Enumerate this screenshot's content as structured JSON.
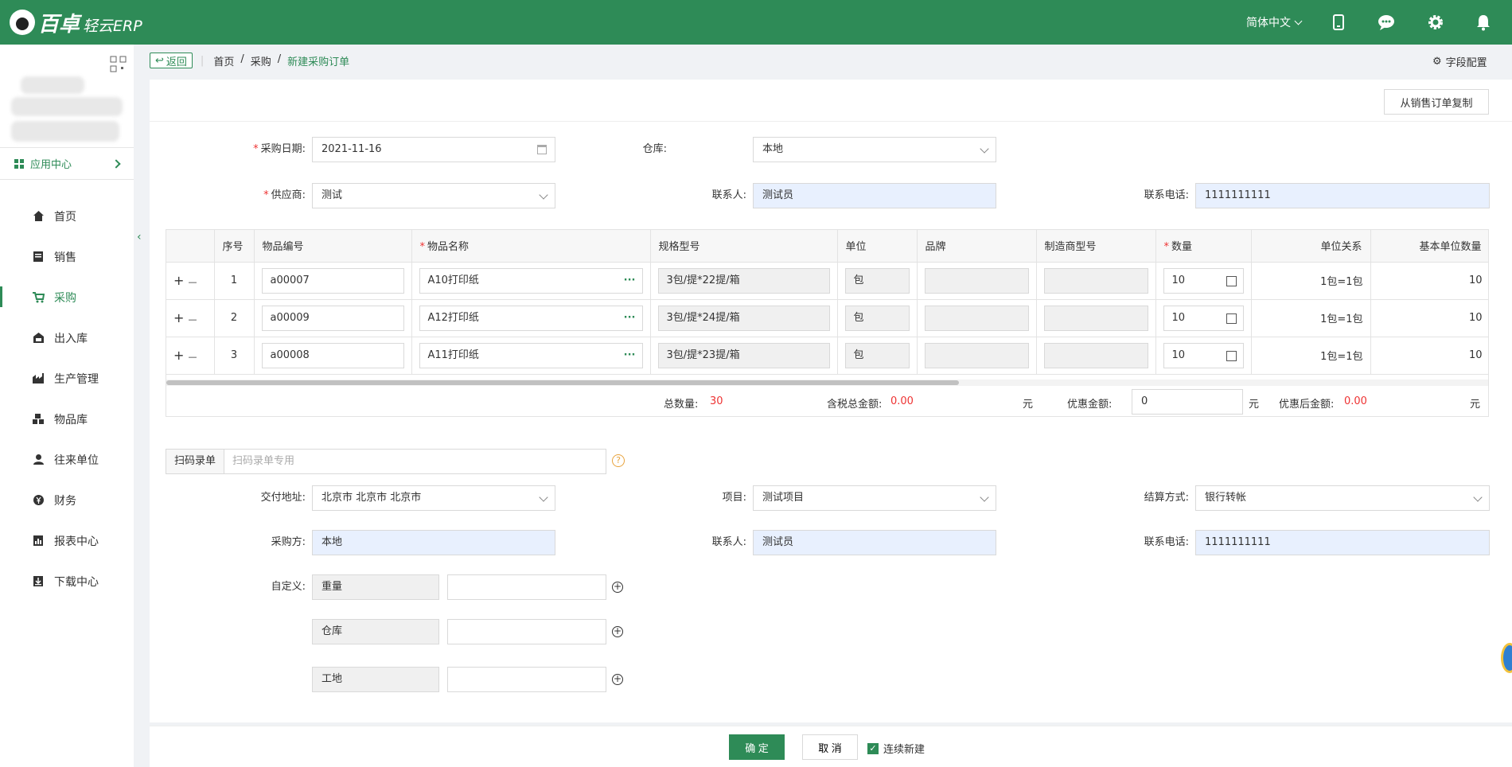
{
  "app": {
    "logo_text": "百卓",
    "logo_sub": "轻云ERP",
    "language": "简体中文"
  },
  "topbar_icons": [
    "mobile-icon",
    "chat-icon",
    "gear-icon",
    "bell-icon"
  ],
  "sidebar": {
    "app_center": "应用中心",
    "items": [
      {
        "label": "首页",
        "icon": "home-icon"
      },
      {
        "label": "销售",
        "icon": "sales-icon"
      },
      {
        "label": "采购",
        "icon": "cart-icon",
        "active": true
      },
      {
        "label": "出入库",
        "icon": "warehouse-icon"
      },
      {
        "label": "生产管理",
        "icon": "factory-icon"
      },
      {
        "label": "物品库",
        "icon": "boxes-icon"
      },
      {
        "label": "往来单位",
        "icon": "user-icon"
      },
      {
        "label": "财务",
        "icon": "yen-icon"
      },
      {
        "label": "报表中心",
        "icon": "report-icon"
      },
      {
        "label": "下载中心",
        "icon": "download-icon"
      }
    ]
  },
  "breadcrumb": {
    "back": "返回",
    "items": [
      "首页",
      "采购",
      "新建采购订单"
    ]
  },
  "field_config": "字段配置",
  "copy_button": "从销售订单复制",
  "form": {
    "purchase_date": {
      "label": "采购日期:",
      "value": "2021-11-16"
    },
    "warehouse": {
      "label": "仓库:",
      "value": "本地"
    },
    "supplier": {
      "label": "供应商:",
      "value": "测试"
    },
    "contact": {
      "label": "联系人:",
      "value": "测试员"
    },
    "phone": {
      "label": "联系电话:",
      "value": "1111111111"
    }
  },
  "table": {
    "columns": [
      "序号",
      "物品编号",
      "物品名称",
      "规格型号",
      "单位",
      "品牌",
      "制造商型号",
      "数量",
      "单位关系",
      "基本单位数量"
    ],
    "rows": [
      {
        "no": "1",
        "code": "a00007",
        "name": "A10打印纸",
        "spec": "3包/提*22提/箱",
        "unit": "包",
        "brand": "",
        "mfr": "",
        "qty": "10",
        "relation": "1包=1包",
        "base_qty": "10"
      },
      {
        "no": "2",
        "code": "a00009",
        "name": "A12打印纸",
        "spec": "3包/提*24提/箱",
        "unit": "包",
        "brand": "",
        "mfr": "",
        "qty": "10",
        "relation": "1包=1包",
        "base_qty": "10"
      },
      {
        "no": "3",
        "code": "a00008",
        "name": "A11打印纸",
        "spec": "3包/提*23提/箱",
        "unit": "包",
        "brand": "",
        "mfr": "",
        "qty": "10",
        "relation": "1包=1包",
        "base_qty": "10"
      }
    ],
    "row_add": "+",
    "row_remove": "—",
    "row_more": "···"
  },
  "summary": {
    "total_qty_label": "总数量:",
    "total_qty": "30",
    "tax_total_label": "含税总金额:",
    "tax_total": "0.00",
    "yuan": "元",
    "discount_label": "优惠金额:",
    "discount": "0",
    "after_label": "优惠后金额:",
    "after": "0.00"
  },
  "scan": {
    "label": "扫码录单",
    "placeholder": "扫码录单专用",
    "help": "?"
  },
  "form2": {
    "address": {
      "label": "交付地址:",
      "value": "北京市 北京市 北京市"
    },
    "project": {
      "label": "项目:",
      "value": "测试项目"
    },
    "settlement": {
      "label": "结算方式:",
      "value": "银行转帐"
    },
    "buyer": {
      "label": "采购方:",
      "value": "本地"
    },
    "contact": {
      "label": "联系人:",
      "value": "测试员"
    },
    "phone": {
      "label": "联系电话:",
      "value": "1111111111"
    },
    "custom_label": "自定义:",
    "custom": [
      {
        "name": "重量",
        "value": ""
      },
      {
        "name": "仓库",
        "value": ""
      },
      {
        "name": "工地",
        "value": ""
      }
    ]
  },
  "bottom": {
    "ok": "确 定",
    "cancel": "取 消",
    "continue": "连续新建"
  }
}
